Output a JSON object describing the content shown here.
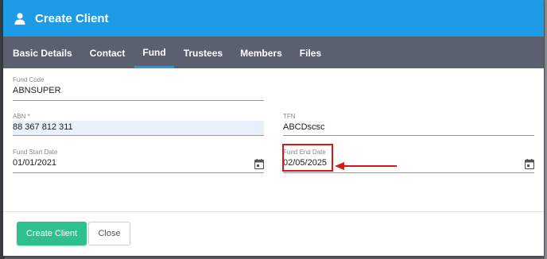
{
  "dialog": {
    "title": "Create Client",
    "icon": "user-icon"
  },
  "tabs": [
    {
      "label": "Basic Details",
      "active": false
    },
    {
      "label": "Contact",
      "active": false
    },
    {
      "label": "Fund",
      "active": true
    },
    {
      "label": "Trustees",
      "active": false
    },
    {
      "label": "Members",
      "active": false
    },
    {
      "label": "Files",
      "active": false
    }
  ],
  "form": {
    "fund_code": {
      "label": "Fund Code",
      "value": "ABNSUPER"
    },
    "abn": {
      "label": "ABN *",
      "value": "88 367 812 311"
    },
    "tfn": {
      "label": "TFN",
      "value": "ABCDscsc"
    },
    "fund_start_date": {
      "label": "Fund Start Date",
      "value": "01/01/2021"
    },
    "fund_end_date": {
      "label": "Fund End Date",
      "value": "02/05/2025"
    }
  },
  "footer": {
    "create_label": "Create Client",
    "close_label": "Close"
  },
  "colors": {
    "header": "#1e9be6",
    "tabs": "#5a606e",
    "create_button": "#2ec08f",
    "annotation": "#d21a1a"
  }
}
